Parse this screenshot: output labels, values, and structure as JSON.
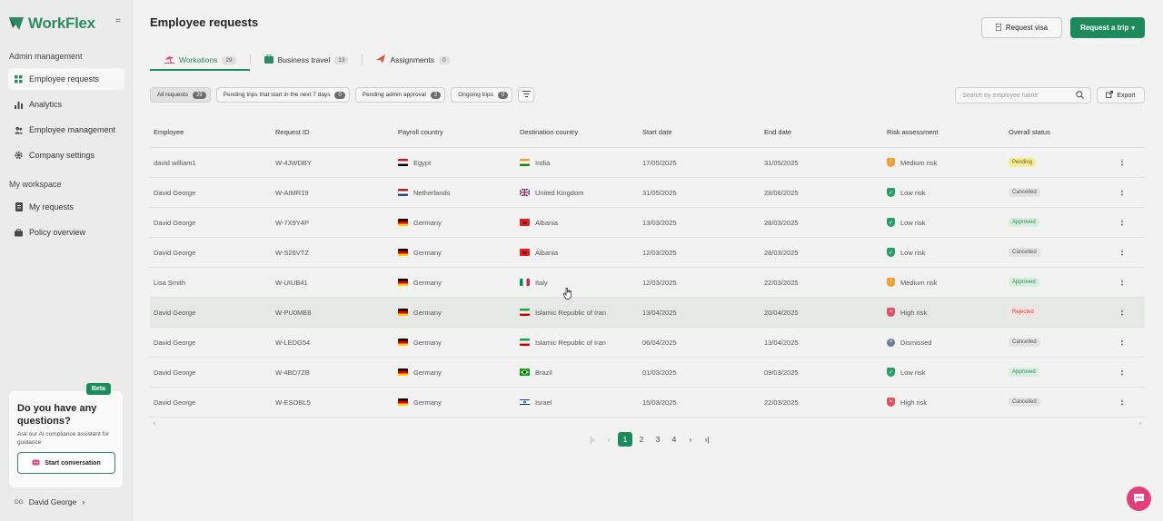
{
  "app": {
    "name": "WorkFlex",
    "brand_color": "#2f8a63",
    "accent_color": "#1e8a5c"
  },
  "sidebar": {
    "admin_label": "Admin management",
    "admin_items": [
      {
        "label": "Employee requests",
        "icon": "grid-icon",
        "active": true
      },
      {
        "label": "Analytics",
        "icon": "bar-chart-icon"
      },
      {
        "label": "Employee management",
        "icon": "users-icon"
      },
      {
        "label": "Company settings",
        "icon": "gear-icon"
      }
    ],
    "workspace_label": "My workspace",
    "workspace_items": [
      {
        "label": "My requests",
        "icon": "document-icon"
      },
      {
        "label": "Policy overview",
        "icon": "briefcase-icon"
      }
    ],
    "help": {
      "badge": "Beta",
      "title": "Do you have any questions?",
      "subtitle": "Ask our AI compliance assistant for guidance",
      "button": "Start conversation"
    },
    "user": {
      "initials": "DG",
      "name": "David George"
    }
  },
  "header": {
    "title": "Employee requests",
    "request_visa": "Request visa",
    "request_trip": "Request a trip"
  },
  "tabs": [
    {
      "label": "Workations",
      "count": "29",
      "icon": "beach-icon",
      "active": true
    },
    {
      "label": "Business travel",
      "count": "13",
      "icon": "suitcase-icon"
    },
    {
      "label": "Assignments",
      "count": "0",
      "icon": "plane-icon"
    }
  ],
  "filters": [
    {
      "label": "All requests",
      "count": "29",
      "active": true
    },
    {
      "label": "Pending trips that start in the next 7 days",
      "count": "0"
    },
    {
      "label": "Pending admin approval",
      "count": "2"
    },
    {
      "label": "Ongoing trips",
      "count": "0"
    }
  ],
  "search": {
    "placeholder": "Search by employee name"
  },
  "export_label": "Export",
  "table": {
    "headers": [
      "Employee",
      "Request ID",
      "Payroll country",
      "Destination country",
      "Start date",
      "End date",
      "Risk assessment",
      "Overall status"
    ],
    "rows": [
      {
        "employee": "david william1",
        "id": "W-4JWDBY",
        "payroll": "Egypt",
        "payroll_flag": "eg",
        "dest": "India",
        "dest_flag": "in",
        "start": "17/05/2025",
        "end": "31/05/2025",
        "risk": "Medium risk",
        "risk_level": "medium",
        "status": "Pending",
        "status_kind": "pending"
      },
      {
        "employee": "David George",
        "id": "W-AIMR19",
        "payroll": "Netherlands",
        "payroll_flag": "nl",
        "dest": "United Kingdom",
        "dest_flag": "gb",
        "start": "31/05/2025",
        "end": "28/06/2025",
        "risk": "Low risk",
        "risk_level": "low",
        "status": "Cancelled",
        "status_kind": "cancelled"
      },
      {
        "employee": "David George",
        "id": "W-7X9Y4P",
        "payroll": "Germany",
        "payroll_flag": "de",
        "dest": "Albania",
        "dest_flag": "al",
        "start": "13/03/2025",
        "end": "28/03/2025",
        "risk": "Low risk",
        "risk_level": "low",
        "status": "Approved",
        "status_kind": "approved"
      },
      {
        "employee": "David George",
        "id": "W-S26VTZ",
        "payroll": "Germany",
        "payroll_flag": "de",
        "dest": "Albania",
        "dest_flag": "al",
        "start": "12/03/2025",
        "end": "28/03/2025",
        "risk": "Low risk",
        "risk_level": "low",
        "status": "Cancelled",
        "status_kind": "cancelled"
      },
      {
        "employee": "Lisa Smith",
        "id": "W-UIUB41",
        "payroll": "Germany",
        "payroll_flag": "de",
        "dest": "Italy",
        "dest_flag": "it",
        "start": "12/03/2025",
        "end": "22/03/2025",
        "risk": "Medium risk",
        "risk_level": "medium",
        "status": "Approved",
        "status_kind": "approved"
      },
      {
        "employee": "David George",
        "id": "W-PU0ME8",
        "payroll": "Germany",
        "payroll_flag": "de",
        "dest": "Islamic Republic of Iran",
        "dest_flag": "ir",
        "start": "13/04/2025",
        "end": "20/04/2025",
        "risk": "High risk",
        "risk_level": "high",
        "status": "Rejected",
        "status_kind": "rejected",
        "highlight": true
      },
      {
        "employee": "David George",
        "id": "W-LEDG54",
        "payroll": "Germany",
        "payroll_flag": "de",
        "dest": "Islamic Republic of Iran",
        "dest_flag": "ir",
        "start": "06/04/2025",
        "end": "13/04/2025",
        "risk": "Dismissed",
        "risk_level": "dismissed",
        "status": "Cancelled",
        "status_kind": "cancelled"
      },
      {
        "employee": "David George",
        "id": "W-4BD7ZB",
        "payroll": "Germany",
        "payroll_flag": "de",
        "dest": "Brazil",
        "dest_flag": "br",
        "start": "01/03/2025",
        "end": "09/03/2025",
        "risk": "Low risk",
        "risk_level": "low",
        "status": "Approved",
        "status_kind": "approved"
      },
      {
        "employee": "David George",
        "id": "W-ESOBL5",
        "payroll": "Germany",
        "payroll_flag": "de",
        "dest": "Israel",
        "dest_flag": "il",
        "start": "15/03/2025",
        "end": "22/03/2025",
        "risk": "High risk",
        "risk_level": "high",
        "status": "Cancelled",
        "status_kind": "cancelled"
      }
    ]
  },
  "pagination": {
    "pages": [
      "1",
      "2",
      "3",
      "4"
    ],
    "current": "1"
  }
}
